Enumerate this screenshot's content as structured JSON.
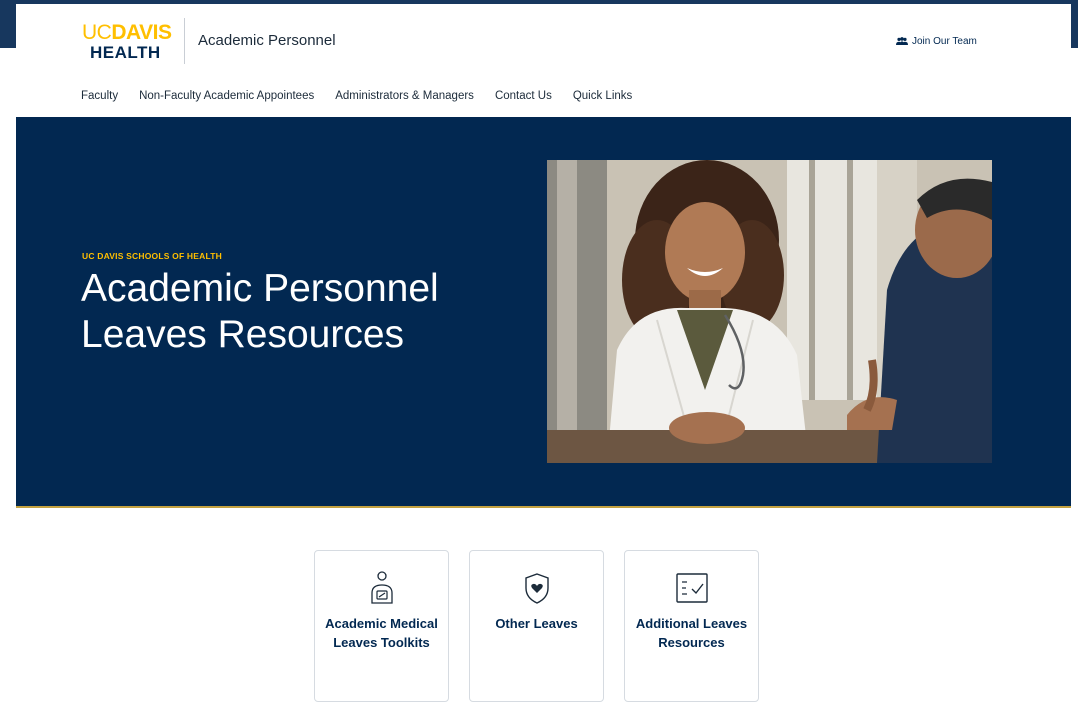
{
  "header": {
    "logo_uc": "UC",
    "logo_davis": "DAVIS",
    "logo_health": "HEALTH",
    "site_name": "Academic Personnel",
    "join_label": "Join Our Team"
  },
  "nav": {
    "items": [
      {
        "label": "Faculty"
      },
      {
        "label": "Non-Faculty Academic Appointees"
      },
      {
        "label": "Administrators & Managers"
      },
      {
        "label": "Contact Us"
      },
      {
        "label": "Quick Links"
      }
    ]
  },
  "hero": {
    "eyebrow": "UC DAVIS SCHOOLS OF HEALTH",
    "title_line1": "Academic Personnel",
    "title_line2": "Leaves Resources",
    "photo_icon": "doctor-patient-photo"
  },
  "cards": [
    {
      "label": "Academic Medical Leaves Toolkits",
      "icon": "person-medical-icon"
    },
    {
      "label": "Other Leaves",
      "icon": "shield-heart-icon"
    },
    {
      "label": "Additional Leaves Resources",
      "icon": "checklist-icon"
    }
  ],
  "colors": {
    "navy": "#022851",
    "gold": "#ffbf00",
    "strip": "#17375e"
  }
}
